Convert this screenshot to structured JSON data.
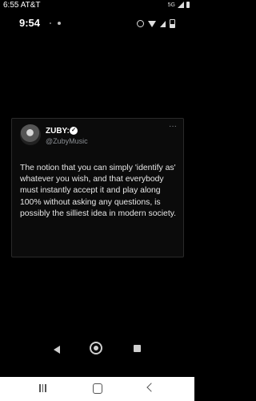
{
  "outer_status": {
    "time": "6:55",
    "carrier": "AT&T",
    "network": "5G"
  },
  "inner_status": {
    "time": "9:54"
  },
  "tweet": {
    "display_name": "ZUBY:",
    "handle": "@ZubyMusic",
    "verified": true,
    "text": "The notion that you can simply 'identify as' whatever you wish, and that everybody must instantly accept it and play along 100% without asking any questions, is possibly the silliest idea in modern society."
  },
  "icons": {
    "verified_badge": "verified-check-icon",
    "more": "more-dots-icon",
    "inner_back": "back-triangle-icon",
    "inner_home": "home-circle-icon",
    "inner_recents": "recents-square-icon",
    "outer_recents": "recents-lines-icon",
    "outer_home": "home-rounded-icon",
    "outer_back": "back-chevron-icon"
  },
  "colors": {
    "background": "#000000",
    "tweet_text": "#e7e7e7",
    "handle": "#8b8f94",
    "card_border": "#2a2a2a",
    "outer_nav": "#ffffff"
  }
}
